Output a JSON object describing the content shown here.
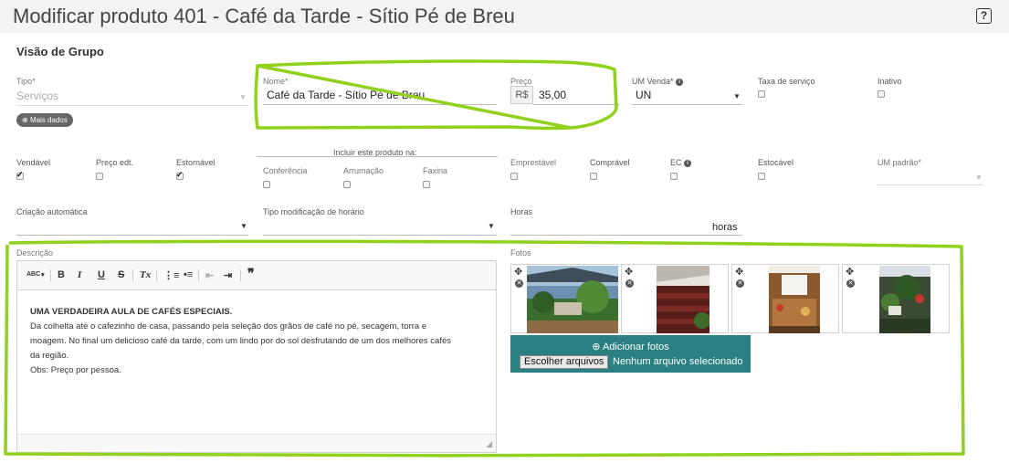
{
  "page": {
    "title": "Modificar produto 401 - Café da Tarde - Sítio Pé de Breu",
    "help_label": "?",
    "group_title": "Visão de Grupo"
  },
  "row1": {
    "tipo_label": "Tipo*",
    "tipo_value": "Serviços",
    "nome_label": "Nome*",
    "nome_value": "Café da Tarde - Sítio Pé de Breu",
    "preco_label": "Preço",
    "preco_prefix": "R$",
    "preco_value": "35,00",
    "um_venda_label": "UM Venda*",
    "um_venda_value": "UN",
    "taxa_label": "Taxa de serviço",
    "inativo_label": "Inativo",
    "mais_dados": "Mais dados"
  },
  "flags": {
    "vendavel": "Vendável",
    "preco_edt": "Preço edt.",
    "estornavel": "Estornável",
    "incluir_title": "Incluir este produto na:",
    "conferencia": "Conferência",
    "arrumacao": "Arrumação",
    "faxina": "Faxina",
    "emprestavel": "Emprestável",
    "compravel": "Comprável",
    "ec": "EC",
    "estocavel": "Estocável",
    "um_padrao": "UM padrão*"
  },
  "row3": {
    "criacao_label": "Criação automática",
    "tipo_mod_label": "Tipo modificação de horário",
    "horas_label": "Horas",
    "horas_suffix": "horas"
  },
  "descricao": {
    "label": "Descrição",
    "heading": "UMA VERDADEIRA AULA DE CAFÉS ESPECIAIS.",
    "line1": "Da colhelta até o cafezinho de casa, passando pela seleção dos grãos de café no pé, secagem, torra e",
    "line2": "moagem. No final um delicioso café da tarde, com um lindo por do sol desfrutando de um dos melhores cafés",
    "line3": "da região.",
    "line4": "Obs: Preço por pessoa.",
    "toolbar": {
      "spell": "ABC",
      "bold": "B",
      "italic": "I",
      "underline": "U",
      "strike": "S",
      "clear": "Tx",
      "quote": "❞"
    }
  },
  "fotos": {
    "label": "Fotos",
    "add_label": "Adicionar fotos",
    "choose_button": "Escolher arquivos",
    "no_file": "Nenhum arquivo selecionado"
  },
  "colors": {
    "highlight": "#8fd11d",
    "upload_bg": "#2a7f81"
  }
}
